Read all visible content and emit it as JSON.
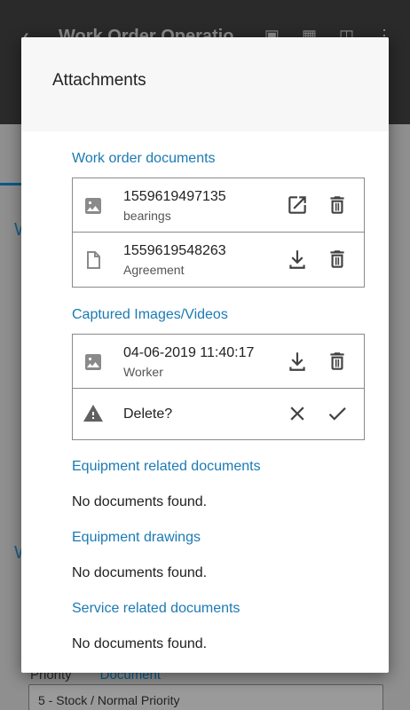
{
  "background": {
    "app_title": "Work Order Operatio",
    "priority_label": "Priority",
    "priority_link": "Document",
    "priority_value": "5 - Stock / Normal Priority",
    "letters": [
      "W",
      "W"
    ]
  },
  "dialog": {
    "title": "Attachments",
    "sections": {
      "work_order": {
        "title": "Work order documents",
        "items": [
          {
            "name": "1559619497135",
            "sub": "bearings",
            "icon": "image-icon",
            "actions": [
              "open-external-icon",
              "trash-icon"
            ]
          },
          {
            "name": "1559619548263",
            "sub": "Agreement",
            "icon": "file-icon",
            "actions": [
              "download-icon",
              "trash-icon"
            ]
          }
        ]
      },
      "captured": {
        "title": "Captured Images/Videos",
        "items": [
          {
            "name": "04-06-2019 11:40:17",
            "sub": "Worker",
            "icon": "image-icon",
            "actions": [
              "download-icon",
              "trash-icon"
            ]
          }
        ],
        "confirm": {
          "text": "Delete?",
          "icon": "warning-icon",
          "actions": [
            "close-icon",
            "check-icon"
          ]
        }
      },
      "equipment_related": {
        "title": "Equipment related documents",
        "empty": "No documents found."
      },
      "equipment_drawings": {
        "title": "Equipment drawings",
        "empty": "No documents found."
      },
      "service_related": {
        "title": "Service related documents",
        "empty": "No documents found."
      }
    }
  },
  "colors": {
    "accent": "#1b7ab4",
    "icon": "#424242",
    "scrim": "#8f8f8f"
  }
}
